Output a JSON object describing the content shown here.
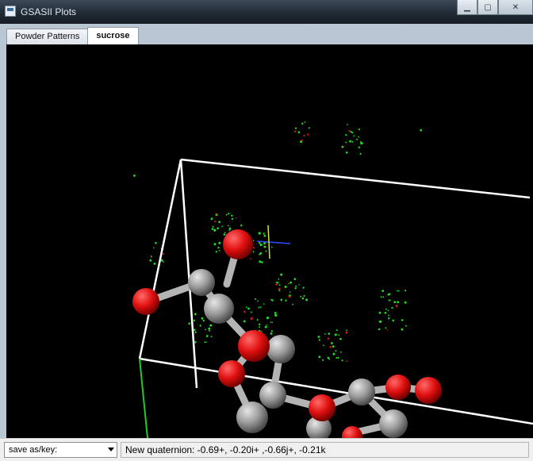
{
  "window": {
    "title": "GSASII Plots",
    "controls": {
      "minimize": "minimize-icon",
      "maximize": "maximize-icon",
      "close": "close-icon"
    }
  },
  "tabs": [
    {
      "label": "Powder Patterns",
      "active": false
    },
    {
      "label": "sucrose",
      "active": true
    }
  ],
  "viewer": {
    "background": "#000000",
    "atom_colors": {
      "carbon": "#9a9a9a",
      "oxygen": "#e01010"
    },
    "cell_color": "#ffffff",
    "density_color": "#22dd22"
  },
  "statusbar": {
    "save_select": "save as/key:",
    "message": "New quaternion: -0.69+, -0.20i+ ,-0.66j+, -0.21k"
  }
}
